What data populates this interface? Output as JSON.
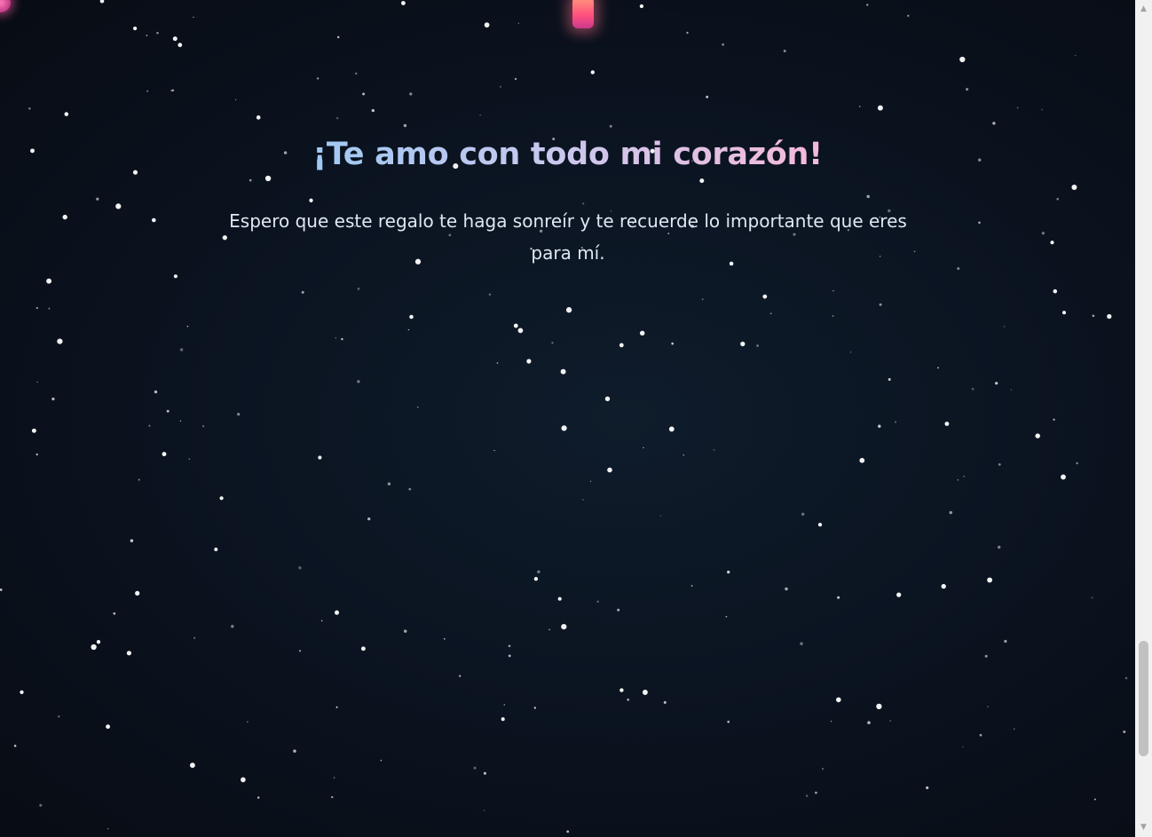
{
  "page": {
    "headline": "¡Te amo con todo mi corazón!",
    "message": "Espero que este regalo te haga sonreír y te recuerde lo importante que eres para mí."
  },
  "decor": {
    "lantern_icon": "lantern-icon",
    "orb_icon": "heart-orb-icon",
    "colors": {
      "background": "#0a0f1a",
      "gradient_start": "#9fc9f2",
      "gradient_end": "#f6b9da",
      "text": "#dfe7f1"
    }
  },
  "scrollbar": {
    "up_icon": "▲",
    "down_icon": "▼"
  }
}
